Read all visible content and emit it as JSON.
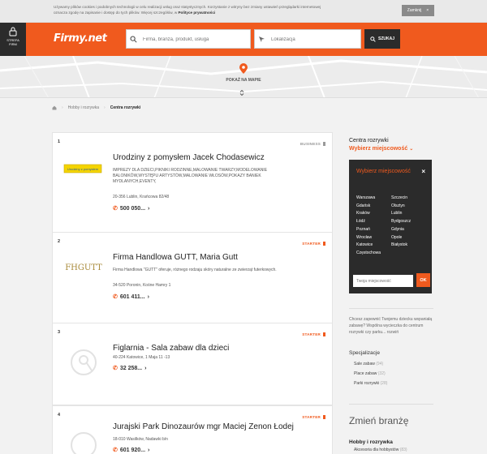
{
  "cookie": {
    "text": "Używamy plików cookies i podobnych technologii w celu realizacji usług oraz statystycznych. Korzystanie z witryny bez zmiany ustawień przeglądarki internetowej oznacza zgodę na zapisanie i dostęp do tych plików. Więcej szczegółów, w",
    "link": "Polityce prywatności",
    "close_label": "Zamknij",
    "close_x": "×"
  },
  "header": {
    "strefa_label_1": "STREFA",
    "strefa_label_2": "FIRM",
    "logo": "Firmy.net",
    "search_placeholder": "Firma, branża, produkt, usługa",
    "location_placeholder": "Lokalizacja",
    "search_button": "SZUKAJ"
  },
  "map": {
    "label": "POKAŻ NA MAPIE",
    "toggle": "⌃⌄"
  },
  "breadcrumb": {
    "items": [
      "Hobby i rozrywka",
      "Centra rozrywki"
    ]
  },
  "listings": [
    {
      "num": "1",
      "badge": "BUSINESS",
      "title": "Urodziny z pomysłem Jacek Chodasewicz",
      "desc": "IMPREZY DLA DZIECI,PIKNIKI RODZINNE,MALOWANIE TWARZY,MODELOWANIE BALONIKÓW,WYSTĘPU ARTYSTÓW,MALOWANIE WŁOSÓW,POKAZY BANIEK MYDLANYCH,EVENTY,",
      "addr": "20-356 Lublin, Krańcowa 82/48",
      "phone": "500 050...",
      "logo_text": "Urodziny z pomysłem"
    },
    {
      "num": "2",
      "badge": "STARTER",
      "title": "Firma Handlowa GUTT, Maria Gutt",
      "desc": "Firma Handlowa \"GUTT\" oferuje, różnego rodzaju skóry naturalne ze zwierząt futerkowych.",
      "addr": "34-520 Poronin, Kośne Hamry 1",
      "phone": "601 411...",
      "logo_text": "FHGUTT"
    },
    {
      "num": "3",
      "badge": "STARTER",
      "title": "Figlarnia - Sala zabaw dla dzieci",
      "desc": "",
      "addr": "40-224 Katowice, 1 Maja 11 -13",
      "phone": "32 258...",
      "logo_text": ""
    },
    {
      "num": "4",
      "badge": "STARTER",
      "title": "Jurajski Park Dinozaurów mgr Maciej Zenon Łodej",
      "desc": "",
      "addr": "18-010 Wasilków, Nadawki b/n",
      "phone": "601 920...",
      "logo_text": ""
    }
  ],
  "sidebar": {
    "title": "Centra rozrywki",
    "choose_city": "Wybierz miejscowość",
    "dropdown": {
      "title": "Wybierz miejscowość",
      "close": "×",
      "col1": [
        "Warszawa",
        "Gdańsk",
        "Kraków",
        "Łódź",
        "Poznań",
        "Wrocław",
        "Katowice",
        "Częstochowa"
      ],
      "col2": [
        "Szczecin",
        "Olsztyn",
        "Lublin",
        "Bydgoszcz",
        "Gdynia",
        "Opole",
        "Białystok"
      ],
      "input_placeholder": "Twoja miejscowość",
      "ok": "OK"
    },
    "info": "Chcesz zapewnić Twojemu dziecku wspaniałą zabawę? Wspólna wycieczka do centrum rozrywki czy parku... rozwiń",
    "spec_title": "Specjalizacje",
    "specs": [
      {
        "label": "Sale zabaw",
        "count": "(94)"
      },
      {
        "label": "Place zabaw",
        "count": "(32)"
      },
      {
        "label": "Parki rozrywki",
        "count": "(28)"
      }
    ],
    "change_title": "Zmień branżę",
    "hobby_title": "Hobby i rozrywka",
    "hobby_item": {
      "label": "Akcesoria dla hobbystów",
      "count": "(83)"
    }
  },
  "colors": {
    "brand": "#f05a1e",
    "dark": "#2b2b2b"
  }
}
